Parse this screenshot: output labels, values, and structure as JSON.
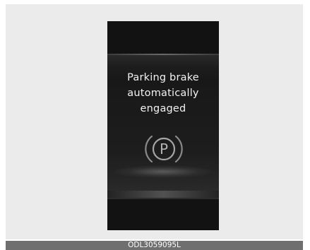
{
  "display": {
    "message_lines": [
      "Parking brake",
      "automatically",
      "engaged"
    ]
  },
  "icon": {
    "name": "parking-brake-icon",
    "letter": "P"
  },
  "caption": {
    "code": "ODL3059095L"
  }
}
